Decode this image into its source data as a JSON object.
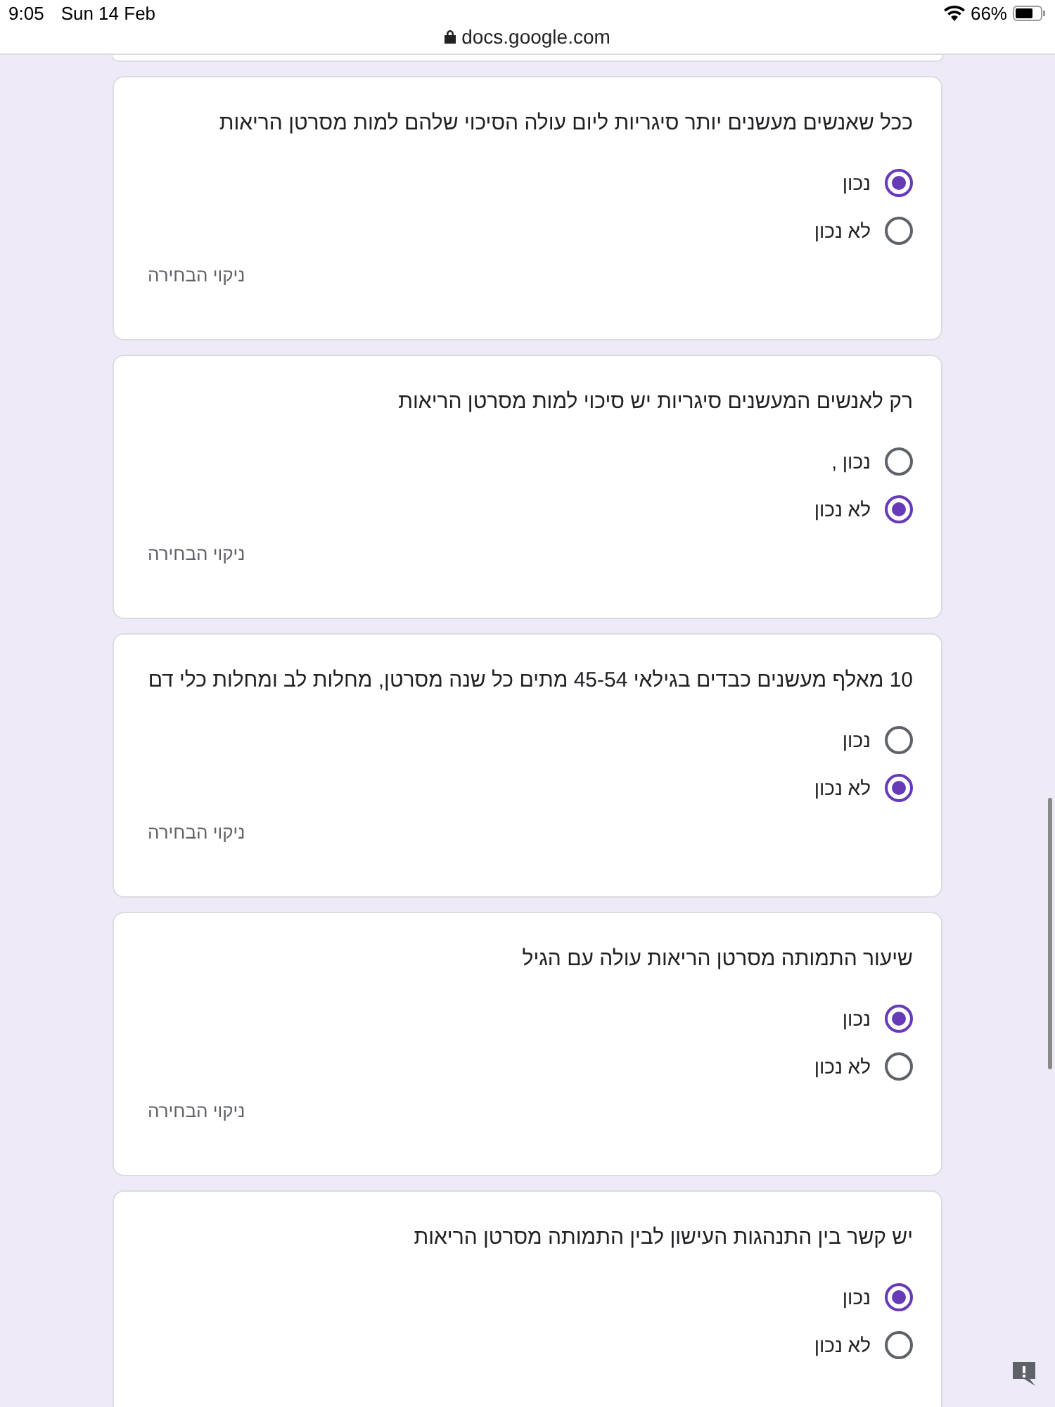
{
  "status_bar": {
    "time": "9:05",
    "date": "Sun 14 Feb",
    "battery": "66%"
  },
  "address_bar": {
    "url": "docs.google.com"
  },
  "questions": [
    {
      "text": "ככל שאנשים מעשנים יותר סיגריות ליום עולה הסיכוי שלהם למות מסרטן הריאות",
      "options": [
        {
          "label": "נכון",
          "selected": true
        },
        {
          "label": "לא נכון",
          "selected": false
        }
      ],
      "clear": "ניקוי הבחירה"
    },
    {
      "text": "רק לאנשים המעשנים סיגריות יש סיכוי למות מסרטן הריאות",
      "options": [
        {
          "label": "נכון ,",
          "selected": false
        },
        {
          "label": "לא נכון",
          "selected": true
        }
      ],
      "clear": "ניקוי הבחירה"
    },
    {
      "text": "10 מאלף מעשנים כבדים בגילאי 45-54 מתים כל שנה מסרטן, מחלות לב ומחלות כלי דם",
      "options": [
        {
          "label": "נכון",
          "selected": false
        },
        {
          "label": "לא נכון",
          "selected": true
        }
      ],
      "clear": "ניקוי הבחירה"
    },
    {
      "text": "שיעור התמותה מסרטן הריאות עולה עם הגיל",
      "options": [
        {
          "label": "נכון",
          "selected": true
        },
        {
          "label": "לא נכון",
          "selected": false
        }
      ],
      "clear": "ניקוי הבחירה"
    },
    {
      "text": "יש קשר בין התנהגות העישון לבין התמותה מסרטן הריאות",
      "options": [
        {
          "label": "נכון",
          "selected": true
        },
        {
          "label": "לא נכון",
          "selected": false
        }
      ]
    }
  ]
}
